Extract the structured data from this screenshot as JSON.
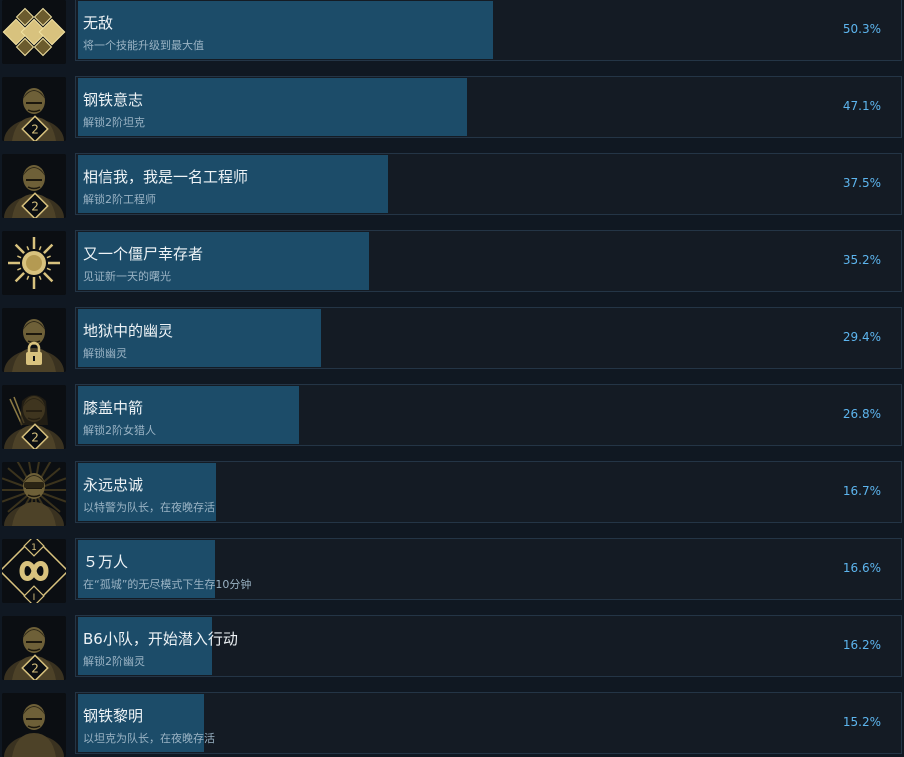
{
  "achievements": [
    {
      "title": "无敌",
      "description": "将一个技能升级到最大值",
      "percent": "50.3%",
      "ratio": 0.503,
      "icon": "diamonds-icon"
    },
    {
      "title": "钢铁意志",
      "description": "解锁2阶坦克",
      "percent": "47.1%",
      "ratio": 0.471,
      "icon": "tank-portrait-icon",
      "badge": "2"
    },
    {
      "title": "相信我，我是一名工程师",
      "description": "解锁2阶工程师",
      "percent": "37.5%",
      "ratio": 0.375,
      "icon": "engineer-portrait-icon",
      "badge": "2"
    },
    {
      "title": "又一个僵尸幸存者",
      "description": "见证新一天的曙光",
      "percent": "35.2%",
      "ratio": 0.352,
      "icon": "sun-icon"
    },
    {
      "title": "地狱中的幽灵",
      "description": "解锁幽灵",
      "percent": "29.4%",
      "ratio": 0.294,
      "icon": "ghost-portrait-lock-icon"
    },
    {
      "title": "膝盖中箭",
      "description": "解锁2阶女猎人",
      "percent": "26.8%",
      "ratio": 0.268,
      "icon": "huntress-portrait-icon",
      "badge": "2"
    },
    {
      "title": "永远忠诚",
      "description": "以特警为队长，在夜晚存活",
      "percent": "16.7%",
      "ratio": 0.167,
      "icon": "swat-portrait-icon"
    },
    {
      "title": "５万人",
      "description": "在“孤城”的无尽模式下生存10分钟",
      "percent": "16.6%",
      "ratio": 0.166,
      "icon": "infinity-icon",
      "badge_top": "1",
      "badge_bottom": "I"
    },
    {
      "title": "B6小队，开始潜入行动",
      "description": "解锁2阶幽灵",
      "percent": "16.2%",
      "ratio": 0.162,
      "icon": "ghost-portrait-icon",
      "badge": "2"
    },
    {
      "title": "钢铁黎明",
      "description": "以坦克为队长，在夜晚存活",
      "percent": "15.2%",
      "ratio": 0.152,
      "icon": "tank-dawn-portrait-icon"
    }
  ]
}
